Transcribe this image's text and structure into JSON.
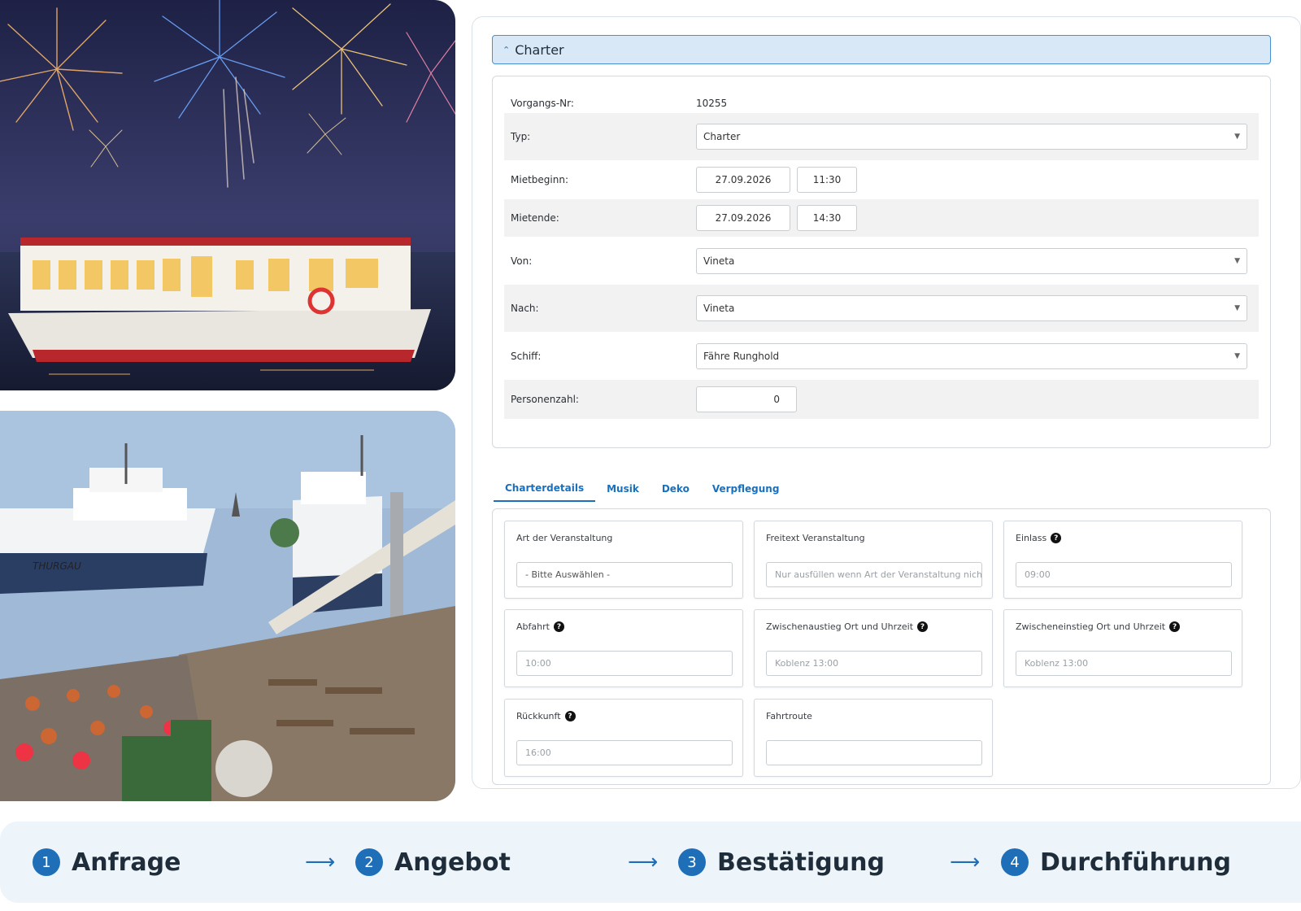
{
  "section": {
    "title": "Charter",
    "chevron_icon": "chevron-up-icon"
  },
  "form": {
    "vorgang": {
      "label": "Vorgangs-Nr:",
      "value": "10255"
    },
    "typ": {
      "label": "Typ:",
      "value": "Charter"
    },
    "mietbeginn": {
      "label": "Mietbeginn:",
      "date": "27.09.2026",
      "time": "11:30"
    },
    "mietende": {
      "label": "Mietende:",
      "date": "27.09.2026",
      "time": "14:30"
    },
    "von": {
      "label": "Von:",
      "value": "Vineta"
    },
    "nach": {
      "label": "Nach:",
      "value": "Vineta"
    },
    "schiff": {
      "label": "Schiff:",
      "value": "Fähre Runghold"
    },
    "personen": {
      "label": "Personenzahl:",
      "value": "0"
    }
  },
  "tabs": [
    {
      "label": "Charterdetails",
      "active": true
    },
    {
      "label": "Musik",
      "active": false
    },
    {
      "label": "Deko",
      "active": false
    },
    {
      "label": "Verpflegung",
      "active": false
    }
  ],
  "details": {
    "art": {
      "label": "Art der Veranstaltung",
      "value": "- Bitte Auswählen -"
    },
    "freitext": {
      "label": "Freitext Veranstaltung",
      "placeholder": "Nur ausfüllen wenn Art der Veranstaltung nicht"
    },
    "einlass": {
      "label": "Einlass",
      "placeholder": "09:00"
    },
    "abfahrt": {
      "label": "Abfahrt",
      "placeholder": "10:00"
    },
    "zwischenausstieg": {
      "label": "Zwischenaustieg Ort und Uhrzeit",
      "placeholder": "Koblenz 13:00"
    },
    "zwischeneinstieg": {
      "label": "Zwischeneinstieg Ort und Uhrzeit",
      "placeholder": "Koblenz 13:00"
    },
    "rueckkunft": {
      "label": "Rückkunft",
      "placeholder": "16:00"
    },
    "fahrtroute": {
      "label": "Fahrtroute",
      "value": ""
    }
  },
  "steps": [
    {
      "num": "1",
      "name": "Anfrage"
    },
    {
      "num": "2",
      "name": "Angebot"
    },
    {
      "num": "3",
      "name": "Bestätigung"
    },
    {
      "num": "4",
      "name": "Durchführung"
    }
  ],
  "colors": {
    "accent": "#1f6fb8",
    "tab": "#1a70bd",
    "header_bg": "#d9e8f6",
    "steps_bg": "#edf4fa"
  }
}
